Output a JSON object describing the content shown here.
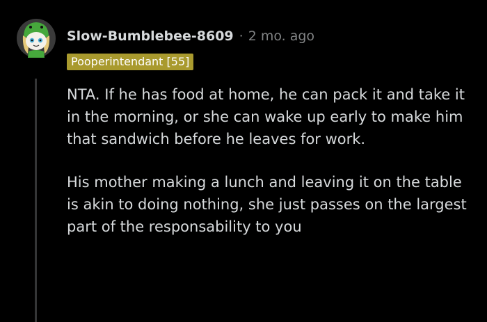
{
  "comment": {
    "author": "Slow-Bumblebee-8609",
    "separator": "·",
    "timestamp": "2 mo. ago",
    "flair": "Pooperintendant [55]",
    "avatar_icon": "snoo-avatar-icon",
    "paragraphs": [
      "NTA. If he has food at home, he can pack it and take it in the morning, or she can wake up early to make him that sandwich before he leaves for work.",
      "His mother making a lunch and leaving it on the table is akin to doing nothing, she just passes on the largest part of the responsability to you"
    ]
  },
  "colors": {
    "background": "#000000",
    "text": "#d7dadc",
    "muted": "#818384",
    "flair_bg": "#a99a2e",
    "thread_line": "#343536",
    "avatar_green": "#46a83c"
  }
}
